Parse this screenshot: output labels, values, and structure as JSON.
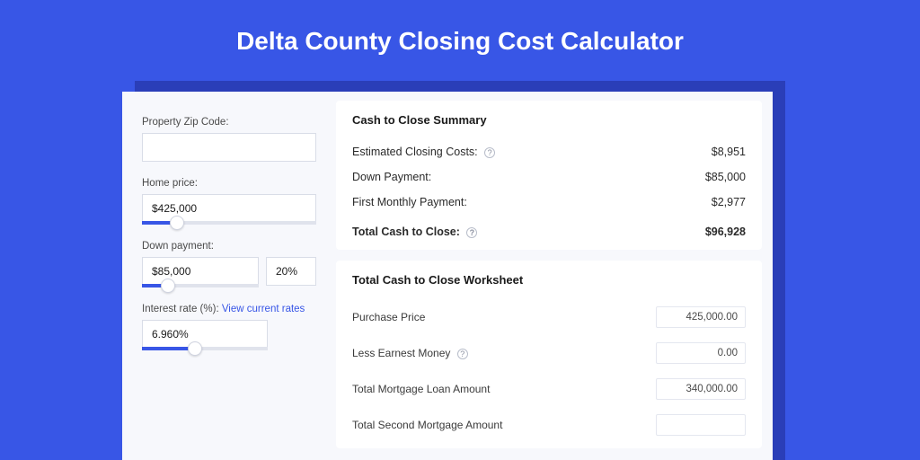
{
  "title": "Delta County Closing Cost Calculator",
  "left": {
    "zip_label": "Property Zip Code:",
    "zip_value": "",
    "home_price_label": "Home price:",
    "home_price_value": "$425,000",
    "home_price_slider_pct": 20,
    "down_payment_label": "Down payment:",
    "down_payment_value": "$85,000",
    "down_payment_pct": "20%",
    "down_payment_slider_pct": 22,
    "interest_label": "Interest rate (%): ",
    "interest_link": "View current rates",
    "interest_value": "6.960%",
    "interest_slider_pct": 42
  },
  "summary": {
    "title": "Cash to Close Summary",
    "rows": [
      {
        "label": "Estimated Closing Costs:",
        "help": true,
        "value": "$8,951"
      },
      {
        "label": "Down Payment:",
        "help": false,
        "value": "$85,000"
      },
      {
        "label": "First Monthly Payment:",
        "help": false,
        "value": "$2,977"
      }
    ],
    "total_label": "Total Cash to Close:",
    "total_value": "$96,928"
  },
  "worksheet": {
    "title": "Total Cash to Close Worksheet",
    "rows": [
      {
        "label": "Purchase Price",
        "help": false,
        "value": "425,000.00"
      },
      {
        "label": "Less Earnest Money",
        "help": true,
        "value": "0.00"
      },
      {
        "label": "Total Mortgage Loan Amount",
        "help": false,
        "value": "340,000.00"
      },
      {
        "label": "Total Second Mortgage Amount",
        "help": false,
        "value": ""
      }
    ]
  }
}
